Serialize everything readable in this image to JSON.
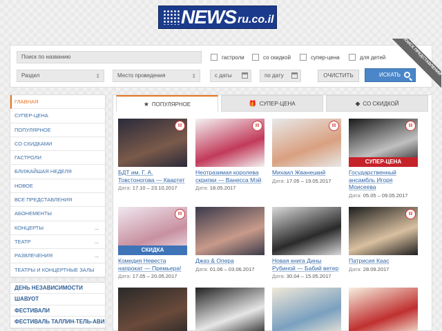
{
  "logo": {
    "news": "NEWS",
    "domain": "ru.co.il"
  },
  "search": {
    "name_placeholder": "Поиск по названию",
    "section": "Раздел",
    "venue": "Место проведения",
    "from_date": "с даты",
    "to_date": "по дату",
    "clear_label": "ОЧИСТИТЬ",
    "search_label": "ИСКАТЬ",
    "checks": [
      "гастроли",
      "со скидкой",
      "супер-цена",
      "для детей"
    ],
    "ribbon": "ПОИСК ПРЕДСТАВЛЕНИЙ"
  },
  "sidebar": {
    "items": [
      {
        "label": "ГЛАВНАЯ",
        "arrow": ""
      },
      {
        "label": "СУПЕР-ЦЕНА",
        "arrow": ""
      },
      {
        "label": "ПОПУЛЯРНОЕ",
        "arrow": ""
      },
      {
        "label": "СО СКИДКАМИ",
        "arrow": ""
      },
      {
        "label": "ГАСТРОЛИ",
        "arrow": ""
      },
      {
        "label": "БЛИЖАЙШАЯ НЕДЕЛЯ",
        "arrow": ""
      },
      {
        "label": "НОВОЕ",
        "arrow": ""
      },
      {
        "label": "ВСЕ ПРЕДСТАВЛЕНИЯ",
        "arrow": ""
      },
      {
        "label": "АБОНЕМЕНТЫ",
        "arrow": ""
      },
      {
        "label": "КОНЦЕРТЫ",
        "arrow": "→"
      },
      {
        "label": "ТЕАТР",
        "arrow": "→"
      },
      {
        "label": "РАЗВЛЕЧЕНИЯ",
        "arrow": "→"
      },
      {
        "label": "ТЕАТРЫ И КОНЦЕРТНЫЕ ЗАЛЫ",
        "arrow": ""
      }
    ],
    "items2": [
      "ДЕНЬ НЕЗАВИСИМОСТИ",
      "ШАВУОТ",
      "ФЕСТИВАЛИ",
      "ФЕСТИВАЛЬ ТАЛЛИН-ТЕЛЬ-АВИВ"
    ]
  },
  "tabs": [
    {
      "label": "ПОПУЛЯРНОЕ",
      "icon": "★"
    },
    {
      "label": "СУПЕР-ЦЕНА",
      "icon": "🎁"
    },
    {
      "label": "СО СКИДКОЙ",
      "icon": "◆"
    }
  ],
  "date_label": "Дата:",
  "cards": [
    {
      "title": "БДТ им. Г. А. Товстоногова — Квартет",
      "date": "17.10 – 23.10.2017",
      "tag": "||||",
      "band": "",
      "colors": [
        "#2a2a3a",
        "#7a5a4a"
      ]
    },
    {
      "title": "Неотразимая королева скрипки — Ванесса Мэй",
      "date": "18.05.2017",
      "tag": "||||",
      "band": "",
      "colors": [
        "#f3f3f3",
        "#c23a5a"
      ]
    },
    {
      "title": "Михаил Жванецкий",
      "date": "17.05 – 19.05.2017",
      "tag": "||||",
      "band": "",
      "colors": [
        "#e8e8e8",
        "#d9a080"
      ]
    },
    {
      "title": "Государственный ансамбль Игоря Моисеева",
      "date": "05.05 – 09.05.2017",
      "tag": "||||",
      "band": "СУПЕР-ЦЕНА",
      "colors": [
        "#1a1a1a",
        "#c0c0c0"
      ]
    },
    {
      "title": "Комедия Невеста напрокат — Премьера!",
      "date": "17.05 – 20.05.2017",
      "tag": "||||",
      "band": "СКИДКА",
      "colors": [
        "#f0e8f0",
        "#c890a0"
      ]
    },
    {
      "title": "Джаз & Опера",
      "date": "01.06 – 03.06.2017",
      "tag": "",
      "band": "",
      "colors": [
        "#3a3a4a",
        "#c89a8a"
      ]
    },
    {
      "title": "Новая книга Дины Рубиной — Бабий ветер",
      "date": "30.04 – 15.05.2017",
      "tag": "",
      "band": "",
      "colors": [
        "#d9d9d9",
        "#2a2a2a"
      ]
    },
    {
      "title": "Патрисия Каас",
      "date": "28.09.2017",
      "tag": "||||",
      "band": "",
      "colors": [
        "#1e1e1e",
        "#d8c0a0"
      ]
    },
    {
      "title": "",
      "date": "",
      "tag": "",
      "band": "",
      "colors": [
        "#2a2a2a",
        "#6a4a3a"
      ]
    },
    {
      "title": "",
      "date": "",
      "tag": "",
      "band": "",
      "colors": [
        "#222",
        "#e6e6e6"
      ]
    },
    {
      "title": "",
      "date": "",
      "tag": "",
      "band": "",
      "colors": [
        "#f0e8d8",
        "#7aa0c0"
      ]
    },
    {
      "title": "",
      "date": "",
      "tag": "",
      "band": "",
      "colors": [
        "#f6f0e0",
        "#c03030"
      ]
    }
  ]
}
